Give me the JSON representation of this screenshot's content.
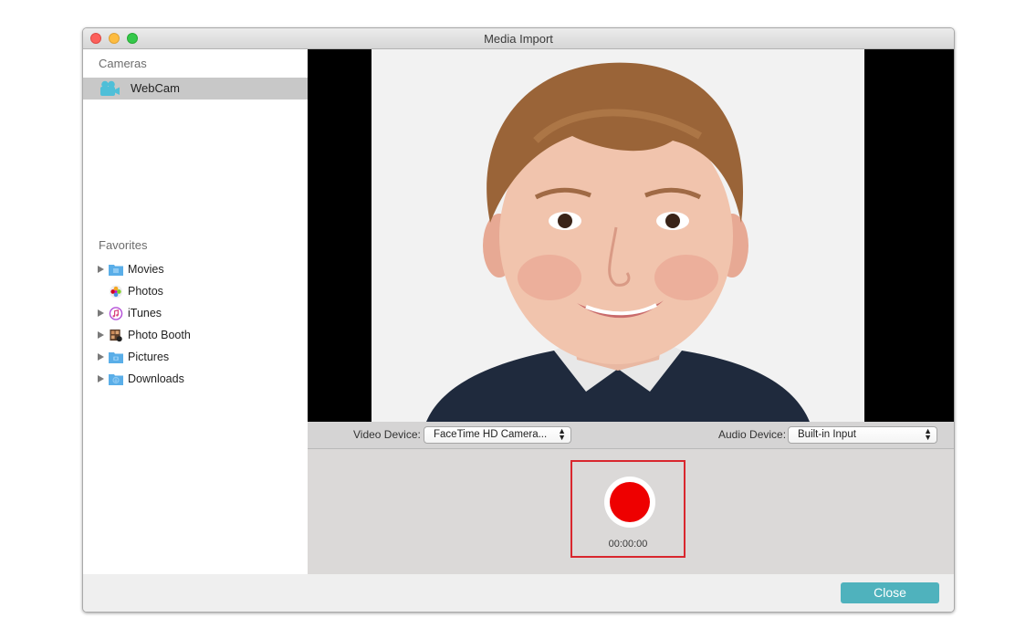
{
  "window": {
    "title": "Media Import"
  },
  "sidebar": {
    "cameras_header": "Cameras",
    "cameras": [
      {
        "label": "WebCam",
        "icon": "video-camera-icon",
        "selected": true
      }
    ],
    "favorites_header": "Favorites",
    "favorites": [
      {
        "label": "Movies",
        "icon": "movies-folder-icon",
        "expandable": true
      },
      {
        "label": "Photos",
        "icon": "photos-app-icon",
        "expandable": false
      },
      {
        "label": "iTunes",
        "icon": "itunes-icon",
        "expandable": true
      },
      {
        "label": "Photo Booth",
        "icon": "photo-booth-icon",
        "expandable": true
      },
      {
        "label": "Pictures",
        "icon": "pictures-folder-icon",
        "expandable": true
      },
      {
        "label": "Downloads",
        "icon": "downloads-folder-icon",
        "expandable": true
      }
    ]
  },
  "controls": {
    "video_device_label": "Video Device:",
    "video_device_value": "FaceTime HD Camera...",
    "audio_device_label": "Audio Device:",
    "audio_device_value": "Built-in Input"
  },
  "recorder": {
    "timer": "00:00:00",
    "record_color": "#ee0000",
    "highlight_color": "#d9272e"
  },
  "footer": {
    "close_label": "Close",
    "accent": "#4fb2bd"
  }
}
